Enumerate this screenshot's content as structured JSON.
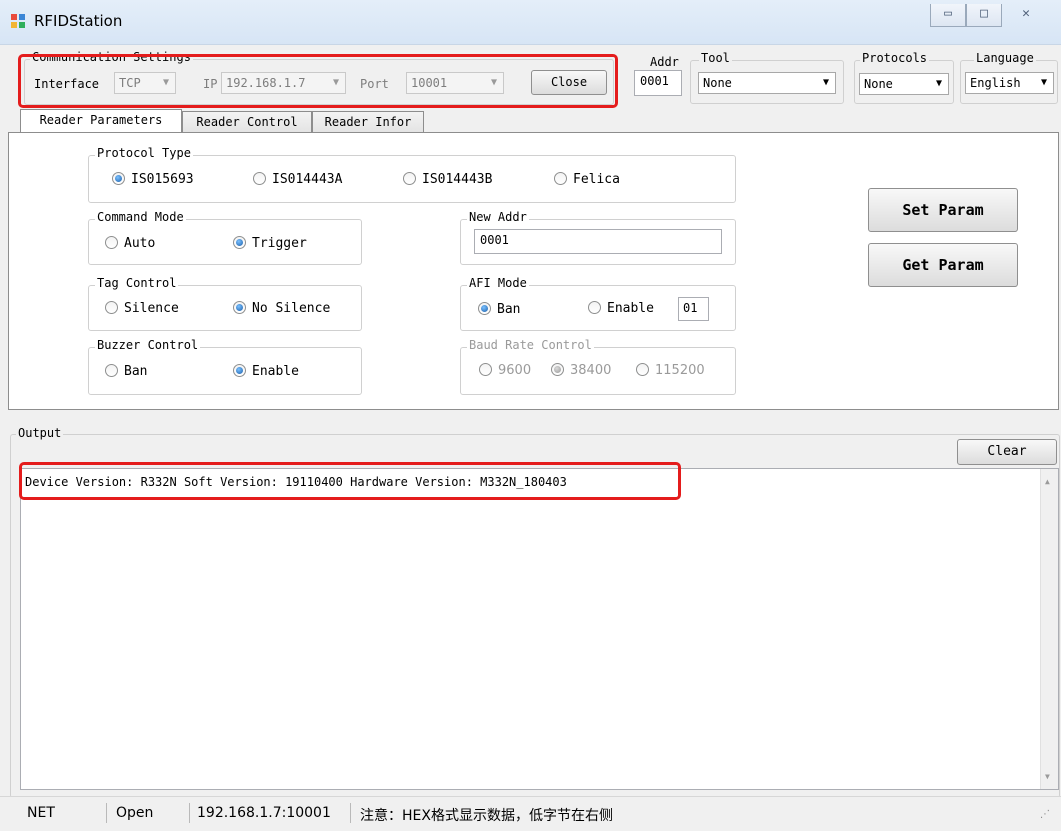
{
  "window": {
    "title": "RFIDStation",
    "controls": {
      "minimize": "▭",
      "maximize": "□",
      "close": "✕"
    }
  },
  "comm": {
    "group_label": "Communication Settings",
    "interface_label": "Interface",
    "interface_value": "TCP",
    "ip_label": "IP",
    "ip_value": "192.168.1.7",
    "port_label": "Port",
    "port_value": "10001",
    "close_button": "Close"
  },
  "addr": {
    "label": "Addr",
    "value": "0001"
  },
  "tool": {
    "label": "Tool",
    "value": "None"
  },
  "protocols": {
    "label": "Protocols",
    "value": "None"
  },
  "language": {
    "label": "Language",
    "value": "English"
  },
  "tabs": [
    {
      "label": "Reader Parameters",
      "active": true
    },
    {
      "label": "Reader Control",
      "active": false
    },
    {
      "label": "Reader Infor",
      "active": false
    }
  ],
  "params": {
    "protocol_type": {
      "label": "Protocol Type",
      "options": [
        "IS015693",
        "IS014443A",
        "IS014443B",
        "Felica"
      ],
      "selected": "IS015693"
    },
    "command_mode": {
      "label": "Command Mode",
      "options": [
        "Auto",
        "Trigger"
      ],
      "selected": "Trigger"
    },
    "tag_control": {
      "label": "Tag Control",
      "options": [
        "Silence",
        "No Silence"
      ],
      "selected": "No Silence"
    },
    "buzzer_control": {
      "label": "Buzzer Control",
      "options": [
        "Ban",
        "Enable"
      ],
      "selected": "Enable"
    },
    "new_addr": {
      "label": "New Addr",
      "value": "0001"
    },
    "afi_mode": {
      "label": "AFI Mode",
      "options": [
        "Ban",
        "Enable"
      ],
      "selected": "Ban",
      "value": "01"
    },
    "baud_rate": {
      "label": "Baud Rate Control",
      "options": [
        "9600",
        "38400",
        "115200"
      ],
      "selected": "38400"
    },
    "set_button": "Set Param",
    "get_button": "Get Param"
  },
  "output": {
    "label": "Output",
    "clear_button": "Clear",
    "text": "Device Version: R332N Soft Version: 19110400  Hardware Version: M332N_180403"
  },
  "status": {
    "mode": "NET",
    "state": "Open",
    "endpoint": "192.168.1.7:10001",
    "note": "注意：HEX格式显示数据，低字节在右侧"
  },
  "colors": {
    "highlight": "#e41c1c",
    "radio_selected": "#1b5faa"
  }
}
